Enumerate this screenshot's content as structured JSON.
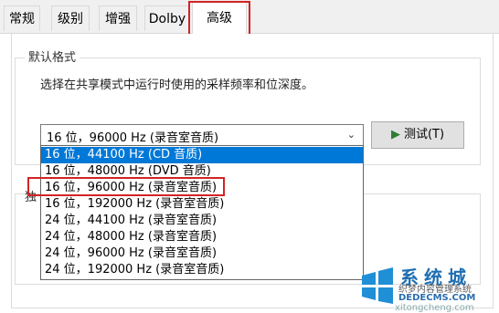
{
  "tabs": [
    {
      "label": "常规"
    },
    {
      "label": "级别"
    },
    {
      "label": "增强"
    },
    {
      "label": "Dolby"
    },
    {
      "label": "高级"
    }
  ],
  "default_format": {
    "group_title": "默认格式",
    "description": "选择在共享模式中运行时使用的采样频率和位深度。",
    "selected_value": "16 位，96000 Hz (录音室音质)",
    "test_button_label": "测试(T)"
  },
  "dropdown": {
    "options": [
      {
        "label": "16 位，44100 Hz (CD 音质)"
      },
      {
        "label": "16 位，48000 Hz (DVD 音质)"
      },
      {
        "label": "16 位，96000 Hz (录音室音质)"
      },
      {
        "label": "16 位，192000 Hz (录音室音质)"
      },
      {
        "label": "24 位，44100 Hz (录音室音质)"
      },
      {
        "label": "24 位，48000 Hz (录音室音质)"
      },
      {
        "label": "24 位，96000 Hz (录音室音质)"
      },
      {
        "label": "24 位，192000 Hz (录音室音质)"
      }
    ],
    "highlighted_index": 0,
    "marked_index": 2
  },
  "exclusive_mode": {
    "group_title": "独"
  },
  "watermark": {
    "brand": "系统城",
    "subtitle": "织梦内容管理系统",
    "url": "DEDECMS.COM",
    "bottom": "xitongcheng.com"
  },
  "colors": {
    "accent": "#0078d7",
    "annotation": "#d22424"
  }
}
